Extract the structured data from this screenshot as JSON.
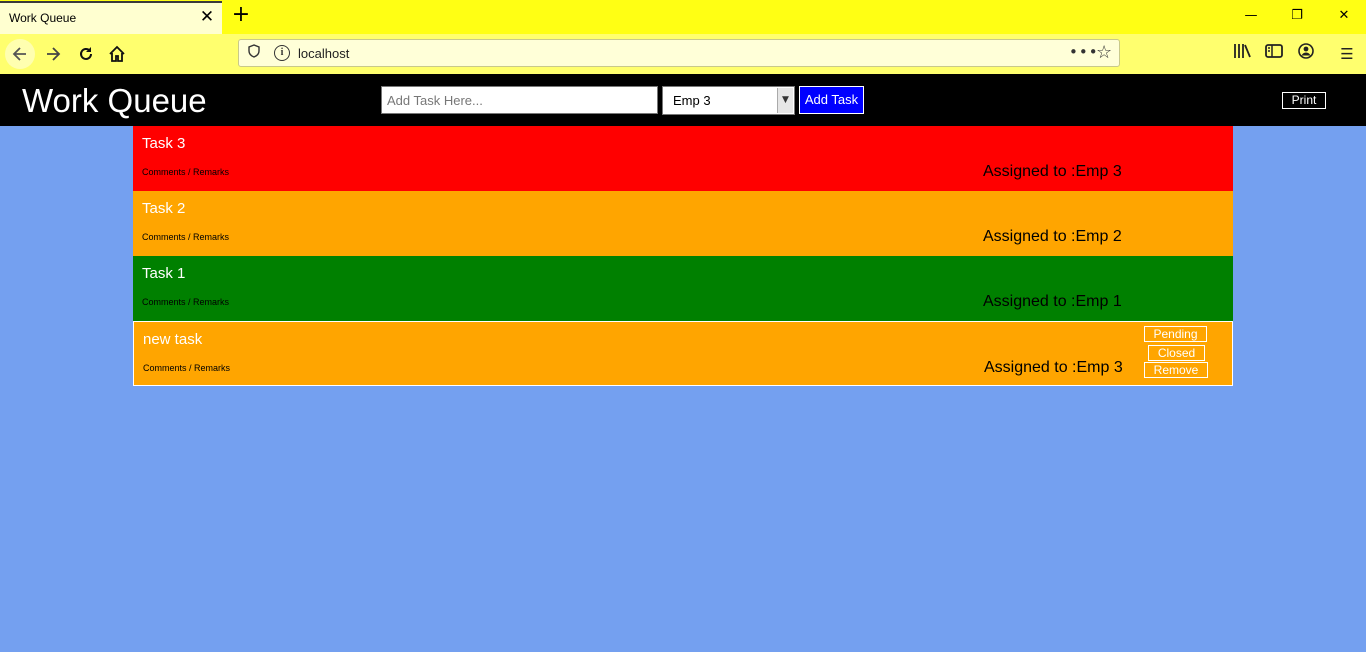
{
  "browser": {
    "tab_title": "Work Queue",
    "tab_close": "✕",
    "new_tab": "+",
    "minimize": "—",
    "maximize": "❐",
    "close": "✕",
    "url": "localhost",
    "menu_icon": "☰"
  },
  "app": {
    "title": "Work Queue",
    "task_input_placeholder": "Add Task Here...",
    "selected_employee": "Emp 3",
    "add_button": "Add Task",
    "print_button": "Print"
  },
  "tasks": [
    {
      "name": "Task 3",
      "comments": "Comments / Remarks",
      "assigned": "Assigned to :Emp 3",
      "color": "#ff0000"
    },
    {
      "name": "Task 2",
      "comments": "Comments / Remarks",
      "assigned": "Assigned to :Emp 2",
      "color": "#ffa500"
    },
    {
      "name": "Task 1",
      "comments": "Comments / Remarks",
      "assigned": "Assigned to :Emp 1",
      "color": "#008000"
    },
    {
      "name": "new task",
      "comments": "Comments / Remarks",
      "assigned": "Assigned to :Emp 3",
      "color": "#ffa500",
      "actions": {
        "pending": "Pending",
        "closed": "Closed",
        "remove": "Remove"
      }
    }
  ]
}
